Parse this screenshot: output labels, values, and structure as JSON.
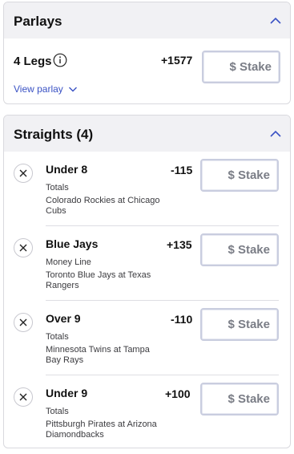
{
  "parlays": {
    "title": "Parlays",
    "legs_label": "4 Legs",
    "odds": "+1577",
    "stake_placeholder": "$ Stake",
    "view_parlay_label": "View parlay"
  },
  "straights": {
    "title": "Straights (4)",
    "stake_placeholder": "$ Stake",
    "bets": [
      {
        "selection": "Under 8",
        "market": "Totals",
        "game": "Colorado Rockies at Chicago Cubs",
        "odds": "-115"
      },
      {
        "selection": "Blue Jays",
        "market": "Money Line",
        "game": "Toronto Blue Jays at Texas Rangers",
        "odds": "+135"
      },
      {
        "selection": "Over 9",
        "market": "Totals",
        "game": "Minnesota Twins at Tampa Bay Rays",
        "odds": "-110"
      },
      {
        "selection": "Under 9",
        "market": "Totals",
        "game": "Pittsburgh Pirates at Arizona Diamondbacks",
        "odds": "+100"
      }
    ]
  },
  "colors": {
    "accent": "#3a52c4",
    "header_bg": "#f1f1f4",
    "stake_border": "#c9cddf"
  }
}
